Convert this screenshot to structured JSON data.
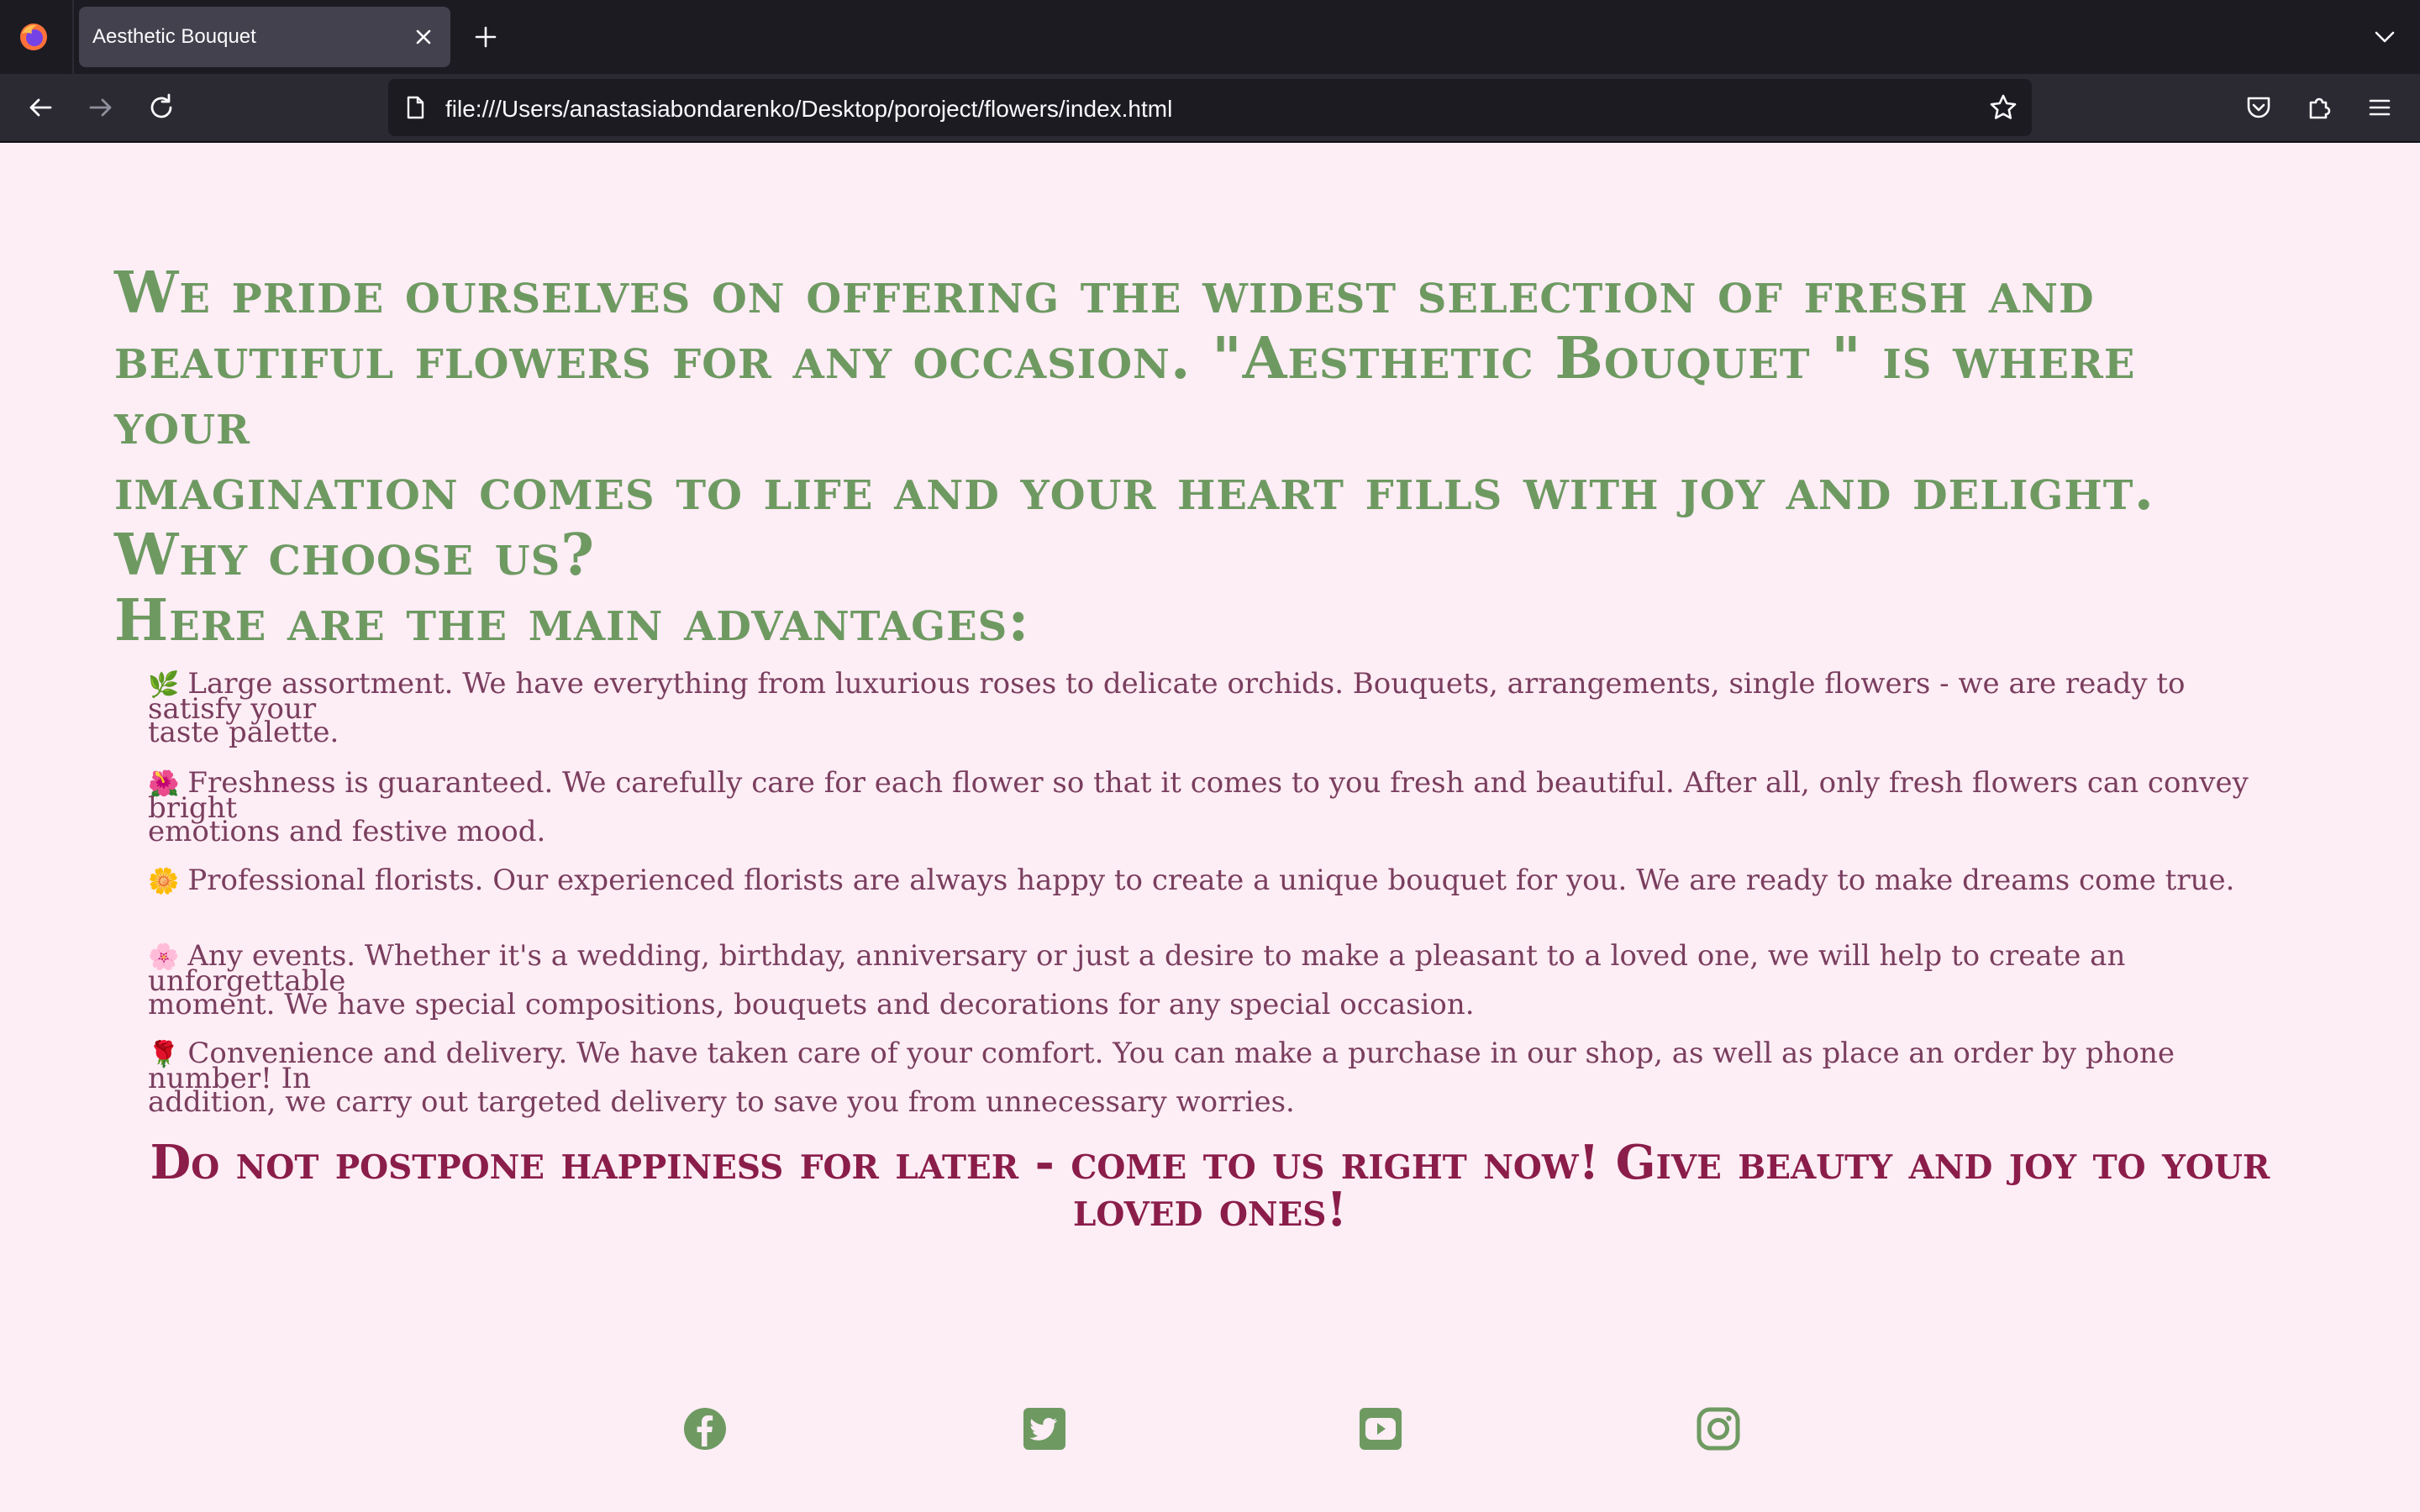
{
  "browser": {
    "tab_title": "Aesthetic Bouquet",
    "url": "file:///Users/anastasiabondarenko/Desktop/poroject/flowers/index.html",
    "icons": {
      "logo": "firefox-logo-icon",
      "close": "close-icon",
      "new_tab": "plus-icon",
      "tab_list": "chevron-down-icon",
      "back": "back-arrow-icon",
      "forward": "forward-arrow-icon",
      "reload": "reload-icon",
      "page": "page-icon",
      "bookmark": "star-icon",
      "pocket": "pocket-icon",
      "extensions": "extensions-icon",
      "menu": "hamburger-menu-icon"
    }
  },
  "page": {
    "intro_lines": [
      "We pride ourselves on offering the widest selection of fresh and",
      "beautiful flowers for any occasion. \"Aesthetic Bouquet \" is where your",
      "imagination comes to life and your heart fills with joy and delight.",
      "Why choose us?",
      "Here are the main advantages:"
    ],
    "advantages": [
      {
        "emoji": "🌿",
        "line1": "Large assortment. We have everything from luxurious roses to delicate orchids. Bouquets, arrangements, single flowers - we are ready to satisfy your",
        "line2": "taste palette."
      },
      {
        "emoji": "🌺",
        "line1": "Freshness is guaranteed. We carefully care for each flower so that it comes to you fresh and beautiful. After all, only fresh flowers can convey bright",
        "line2": "emotions and festive mood."
      },
      {
        "emoji": "🌼",
        "line1": "Professional florists. Our experienced florists are always happy to create a unique bouquet for you. We are ready to make dreams come true.",
        "line2": ""
      },
      {
        "emoji": "🌸",
        "line1": "Any events. Whether it's a wedding, birthday, anniversary or just a desire to make a pleasant to a loved one, we will help to create an unforgettable",
        "line2": "moment. We have special compositions, bouquets and decorations for any special occasion."
      },
      {
        "emoji": "🌹",
        "line1": "Convenience and delivery. We have taken care of your comfort. You can make a purchase in our shop, as well as place an order by phone number! In",
        "line2": "addition, we carry out targeted delivery to save you from unnecessary worries."
      }
    ],
    "cta_lines": [
      "Do not postpone happiness for later - come to us right now! Give beauty and joy to your",
      "loved ones!"
    ],
    "social": [
      "facebook-icon",
      "twitter-icon",
      "youtube-icon",
      "instagram-icon"
    ],
    "colors": {
      "background": "#fdedf5",
      "heading_green": "#6e9a62",
      "text_plum": "#7a3e5e",
      "cta_burgundy": "#8a1d4a",
      "chrome_dark": "#1c1b22",
      "chrome_toolbar": "#2b2a33"
    }
  }
}
